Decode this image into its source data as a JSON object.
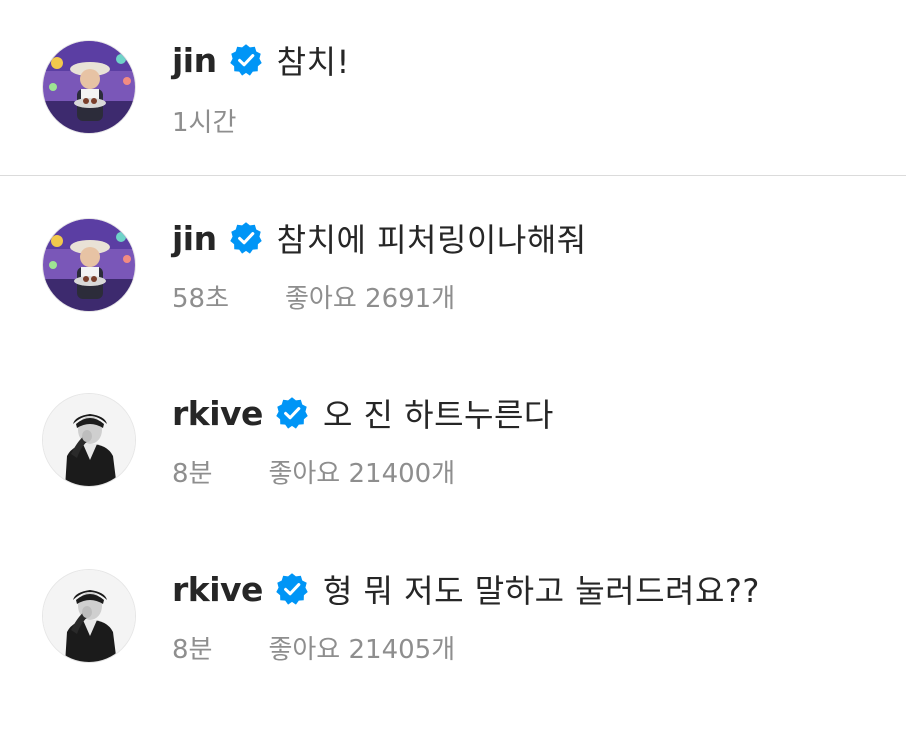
{
  "caption": {
    "username": "jin",
    "verified_icon": "verified-badge-icon",
    "text": "참치!",
    "time": "1시간"
  },
  "comments": [
    {
      "username": "jin",
      "verified_icon": "verified-badge-icon",
      "text": "참치에 피처링이나해줘",
      "time": "58초",
      "likes": "좋아요 2691개"
    },
    {
      "username": "rkive",
      "verified_icon": "verified-badge-icon",
      "text": "오 진 하트누른다",
      "time": "8분",
      "likes": "좋아요 21400개"
    },
    {
      "username": "rkive",
      "verified_icon": "verified-badge-icon",
      "text": "형 뭐 저도 말하고 눌러드려요??",
      "time": "8분",
      "likes": "좋아요 21405개"
    }
  ],
  "colors": {
    "verified_blue": "#0095f6",
    "text": "#262626",
    "meta": "#8e8e8e",
    "divider": "#dbdbdb"
  }
}
